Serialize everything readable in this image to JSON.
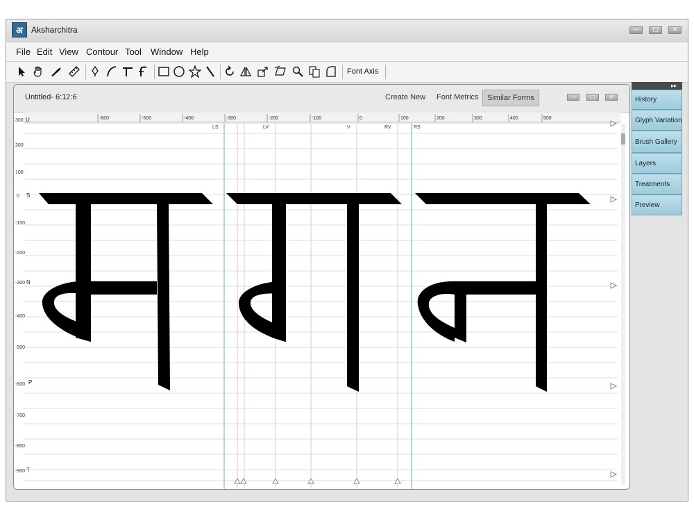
{
  "window": {
    "title": "Aksharchitra",
    "logo_glyph": "अ",
    "controls": [
      "—",
      "□",
      "✕"
    ]
  },
  "menu": [
    "File",
    "Edit",
    "View",
    "Contour",
    "Tool",
    "Window",
    "Help"
  ],
  "toolbar": {
    "tools": [
      "pointer-icon",
      "hand-icon",
      "knife-icon",
      "ruler-icon",
      "pen-icon",
      "curve-icon",
      "corner-icon",
      "hook-icon",
      "rectangle-icon",
      "ellipse-icon",
      "star-icon",
      "line-icon",
      "rotate-icon",
      "mirror-icon",
      "scale-icon",
      "skew-icon",
      "zoom-icon",
      "copy-icon",
      "shape-icon"
    ],
    "font_axis_label": "Font Axis"
  },
  "document": {
    "title": "Untitled- 6:12:6",
    "buttons": [
      "Create New",
      "Font Metrics",
      "Similar Forms"
    ],
    "active_button": "Similar Forms",
    "controls": [
      "—",
      "□",
      "✕"
    ]
  },
  "ruler": {
    "x_ticks": [
      "-600",
      "-500",
      "-400",
      "-300",
      "-200",
      "-100",
      "0",
      "100",
      "200",
      "300",
      "400",
      "500"
    ],
    "y_ticks": [
      "300",
      "200",
      "100",
      "0",
      "-100",
      "-200",
      "-300",
      "-400",
      "-500",
      "-600",
      "-700",
      "-800",
      "-900"
    ],
    "row_labels": [
      "U",
      "S",
      "N",
      "P",
      "T"
    ],
    "guide_labels": [
      "LS",
      "LV",
      "V",
      "RV",
      "RS"
    ]
  },
  "side_panel": {
    "toggle": "▸▸",
    "items": [
      "History",
      "Glyph Variations",
      "Brush Gallery",
      "Layers",
      "Treatments",
      "Preview"
    ]
  }
}
